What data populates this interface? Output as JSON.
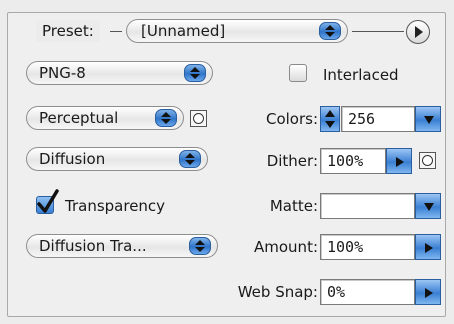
{
  "preset": {
    "label": "Preset:",
    "value": "[Unnamed]",
    "menu_icon": "play-circle-icon"
  },
  "left": {
    "format": "PNG-8",
    "reduction": "Perceptual",
    "dither_algorithm": "Diffusion",
    "transparency_label": "Transparency",
    "transparency_checked": true,
    "transparency_dither": "Diffusion Tra..."
  },
  "right": {
    "interlaced_label": "Interlaced",
    "interlaced_checked": false,
    "colors_label": "Colors:",
    "colors_value": "256",
    "dither_label": "Dither:",
    "dither_value": "100%",
    "matte_label": "Matte:",
    "matte_value": "",
    "amount_label": "Amount:",
    "amount_value": "100%",
    "websnap_label": "Web Snap:",
    "websnap_value": "0%"
  },
  "colors": {
    "aqua_blue": "#3a7fd3",
    "border": "#8e8e8e",
    "panel": "#efefef"
  }
}
